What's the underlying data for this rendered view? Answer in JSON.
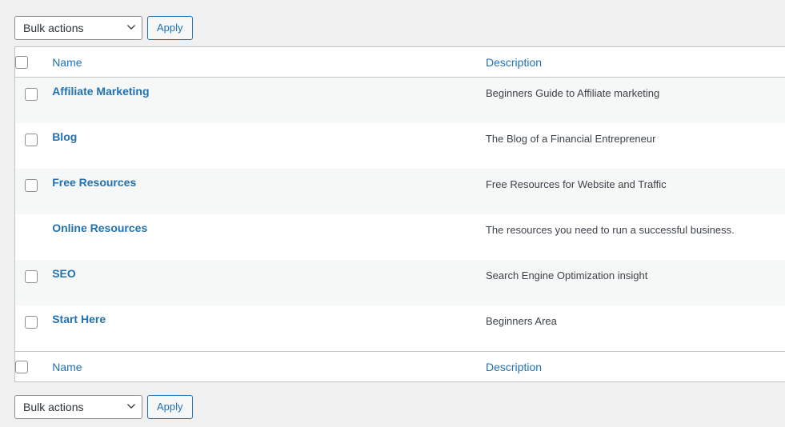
{
  "toolbar_top": {
    "bulk_select_value": "Bulk actions",
    "apply_label": "Apply",
    "chevron_icon": "chevron-down-icon"
  },
  "toolbar_bottom": {
    "bulk_select_value": "Bulk actions",
    "apply_label": "Apply",
    "chevron_icon": "chevron-down-icon"
  },
  "table": {
    "columns": {
      "name": "Name",
      "description": "Description"
    },
    "footer_columns": {
      "name": "Name",
      "description": "Description"
    },
    "rows": [
      {
        "name": "Affiliate Marketing",
        "description": "Beginners Guide to Affiliate marketing",
        "has_checkbox": true,
        "is_child": false
      },
      {
        "name": "Blog",
        "description": "The Blog of a Financial Entrepreneur",
        "has_checkbox": true,
        "is_child": false
      },
      {
        "name": "Free Resources",
        "description": "Free Resources for Website and Traffic",
        "has_checkbox": true,
        "is_child": false
      },
      {
        "name": "Online Resources",
        "description": "The resources you need to run a successful business.",
        "has_checkbox": false,
        "is_child": true
      },
      {
        "name": "SEO",
        "description": "Search Engine Optimization insight",
        "has_checkbox": true,
        "is_child": false
      },
      {
        "name": "Start Here",
        "description": "Beginners Area",
        "has_checkbox": true,
        "is_child": false
      }
    ]
  },
  "colors": {
    "link": "#2271b1",
    "page_background": "#f0f0f1",
    "row_stripe": "#f6f7f7",
    "border": "#c3c4c7",
    "text": "#3c434a"
  }
}
